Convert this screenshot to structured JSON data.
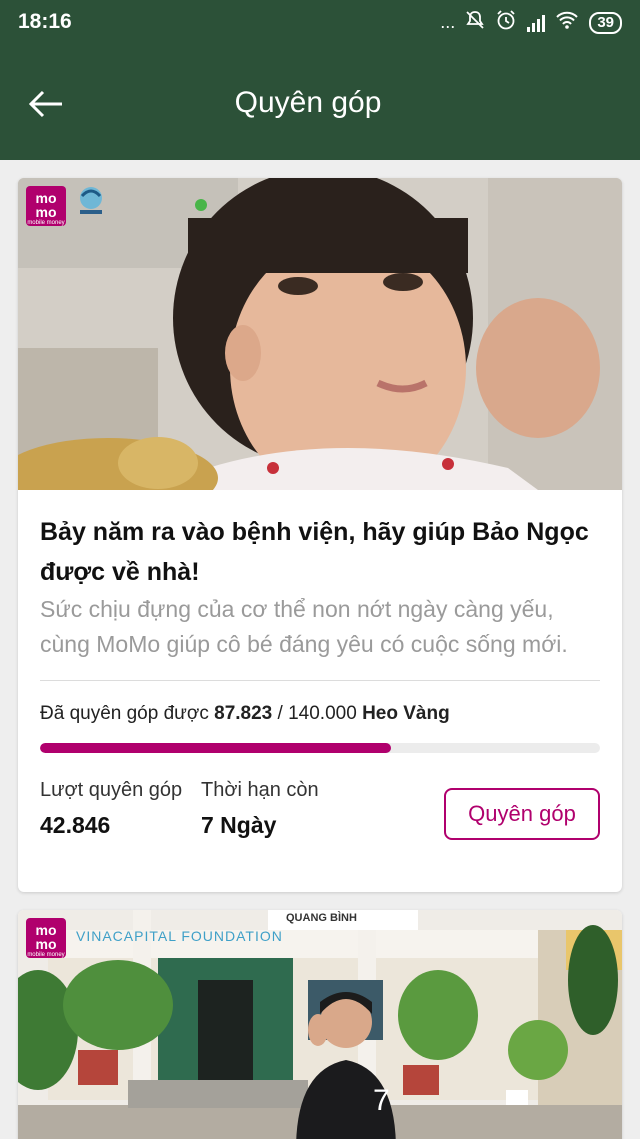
{
  "status_bar": {
    "time": "18:16",
    "dots": "...",
    "battery": "39"
  },
  "app_bar": {
    "title": "Quyên góp"
  },
  "campaigns": [
    {
      "brand": {
        "line1": "mo",
        "line2": "mo",
        "tagline": "mobile money"
      },
      "headline": "Bảy năm ra vào bệnh viện, hãy giúp Bảo Ngọc được về nhà!",
      "description": "Sức chịu đựng của cơ thể non nớt ngày càng yếu, cùng MoMo giúp cô bé đáng yêu có cuộc sống mới.",
      "raised_prefix": "Đã quyên góp được ",
      "raised_amount": "87.823",
      "raised_separator": " / ",
      "goal_amount": "140.000",
      "unit": "Heo Vàng",
      "progress_fraction": 0.627,
      "donors_label": "Lượt quyên góp",
      "donors_value": "42.846",
      "time_left_label": "Thời hạn còn",
      "time_left_value": "7 Ngày",
      "donate_button": "Quyên góp"
    },
    {
      "brand": {
        "line1": "mo",
        "line2": "mo",
        "tagline": "mobile money"
      },
      "partner": "VINACAPITAL FOUNDATION",
      "sign_text": "QUANG BÌNH"
    }
  ],
  "colors": {
    "header": "#2c5138",
    "accent": "#b0006d"
  }
}
